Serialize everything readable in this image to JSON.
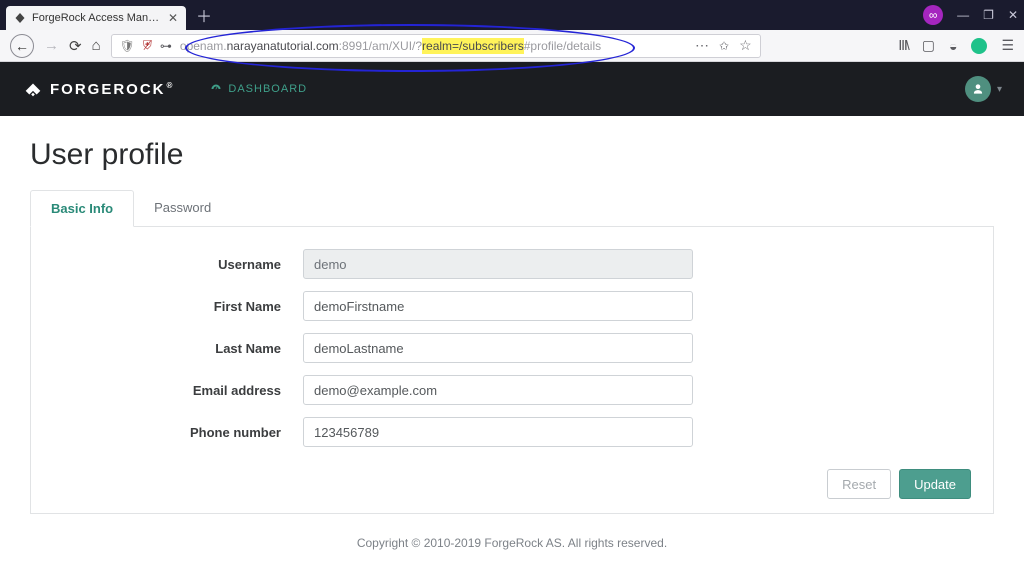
{
  "browser": {
    "tab_title": "ForgeRock Access Managemen",
    "url_plain_prefix": "openam.",
    "url_host": "narayanatutorial.com",
    "url_port_path": ":8991/am/XUI/?",
    "url_highlight": "realm=/subscribers",
    "url_suffix": "#profile/details"
  },
  "header": {
    "brand": "FORGEROCK",
    "dashboard": "DASHBOARD"
  },
  "page_title": "User profile",
  "tabs": {
    "basic_info": "Basic Info",
    "password": "Password"
  },
  "form": {
    "username_label": "Username",
    "username_value": "demo",
    "firstname_label": "First Name",
    "firstname_value": "demoFirstname",
    "lastname_label": "Last Name",
    "lastname_value": "demoLastname",
    "email_label": "Email address",
    "email_value": "demo@example.com",
    "phone_label": "Phone number",
    "phone_value": "123456789"
  },
  "buttons": {
    "reset": "Reset",
    "update": "Update"
  },
  "footer": "Copyright © 2010-2019 ForgeRock AS. All rights reserved."
}
